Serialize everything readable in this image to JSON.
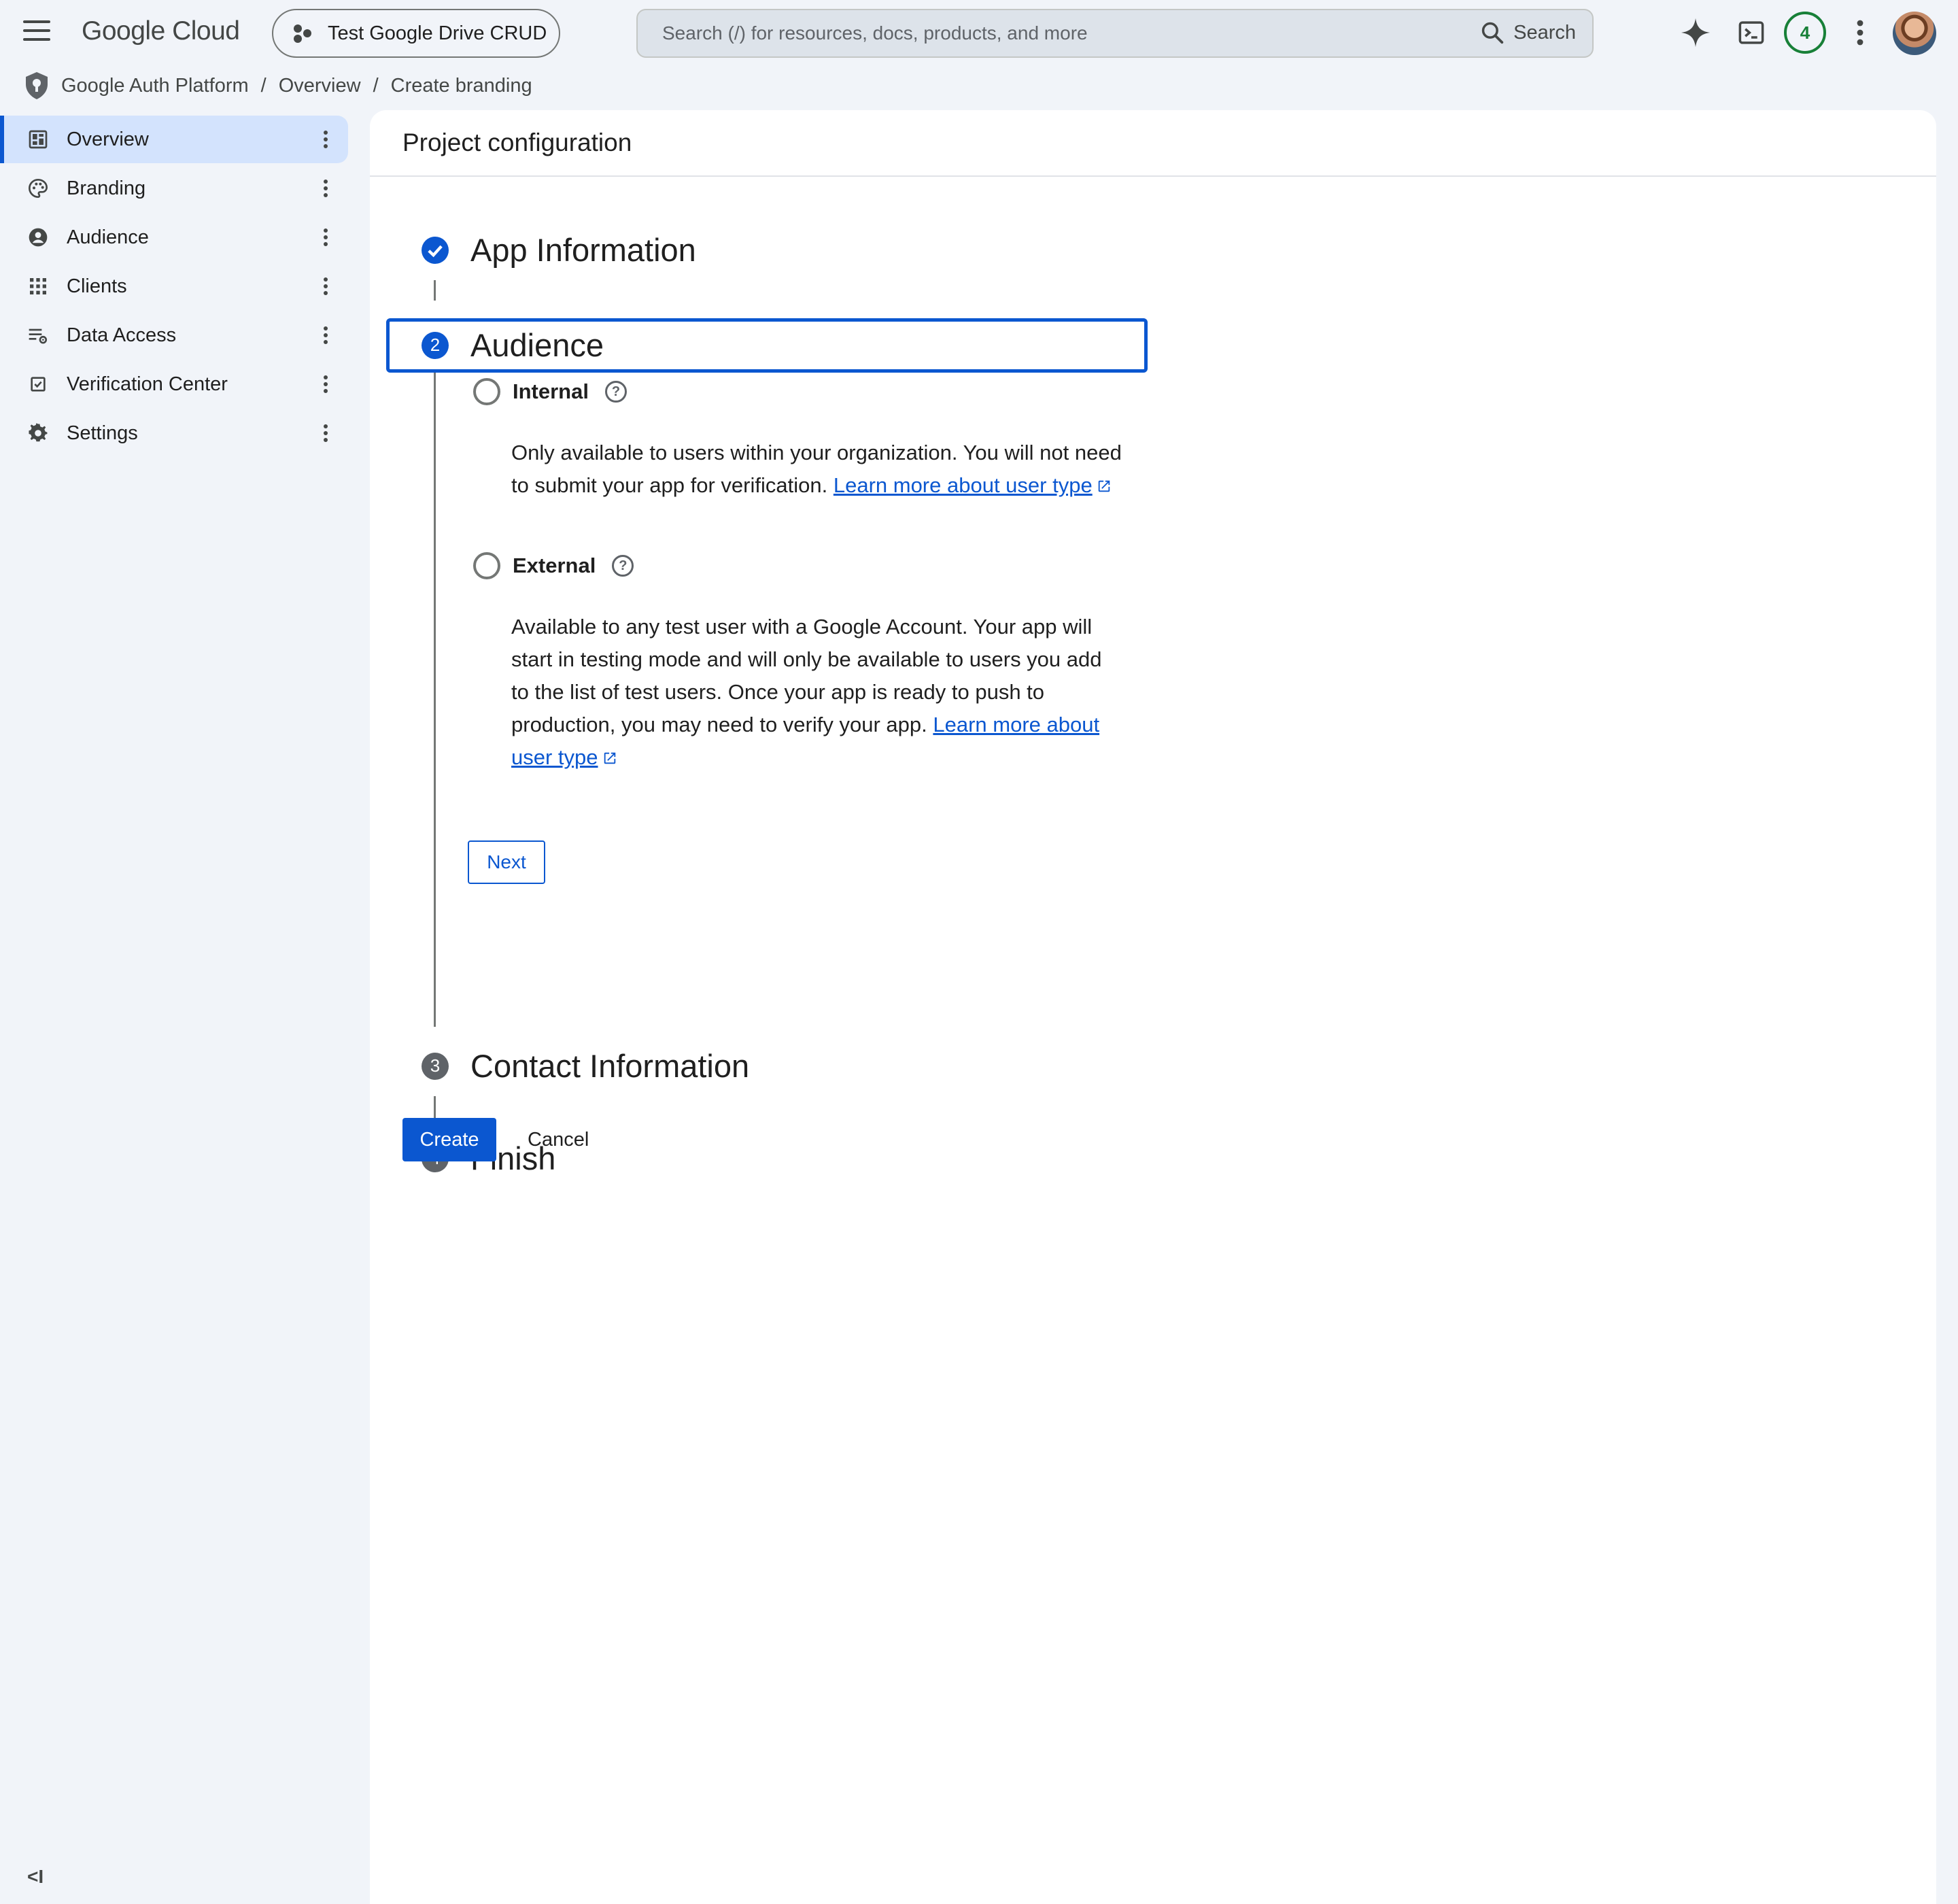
{
  "header": {
    "logo": "Google Cloud",
    "project": "Test Google Drive CRUD",
    "search_placeholder": "Search (/) for resources, docs, products, and more",
    "search_button": "Search",
    "notification_count": "4"
  },
  "breadcrumb": {
    "items": [
      "Google Auth Platform",
      "Overview",
      "Create branding"
    ],
    "separator": "/"
  },
  "sidebar": {
    "items": [
      {
        "label": "Overview",
        "icon": "dashboard-icon",
        "active": true
      },
      {
        "label": "Branding",
        "icon": "palette-icon",
        "active": false
      },
      {
        "label": "Audience",
        "icon": "account-circle-icon",
        "active": false
      },
      {
        "label": "Clients",
        "icon": "apps-grid-icon",
        "active": false
      },
      {
        "label": "Data Access",
        "icon": "data-settings-icon",
        "active": false
      },
      {
        "label": "Verification Center",
        "icon": "verified-checkbox-icon",
        "active": false
      },
      {
        "label": "Settings",
        "icon": "gear-icon",
        "active": false
      }
    ],
    "collapse_label": "<I"
  },
  "main": {
    "title": "Project configuration",
    "steps": [
      {
        "number": "1",
        "title": "App Information",
        "state": "done"
      },
      {
        "number": "2",
        "title": "Audience",
        "state": "current"
      },
      {
        "number": "3",
        "title": "Contact Information",
        "state": "pending"
      },
      {
        "number": "4",
        "title": "Finish",
        "state": "pending"
      }
    ],
    "audience": {
      "internal": {
        "label": "Internal",
        "description": "Only available to users within your organization. You will not need to submit your app for verification.",
        "link": "Learn more about user type"
      },
      "external": {
        "label": "External",
        "description": "Available to any test user with a Google Account. Your app will start in testing mode and will only be available to users you add to the list of test users. Once your app is ready to push to production, you may need to verify your app.",
        "link": "Learn more about user type"
      },
      "next_label": "Next"
    },
    "create_label": "Create",
    "cancel_label": "Cancel"
  },
  "colors": {
    "accent": "#0b57d0",
    "background": "#f1f4f9",
    "active_nav": "#d3e3fd",
    "badge_green": "#188038"
  }
}
